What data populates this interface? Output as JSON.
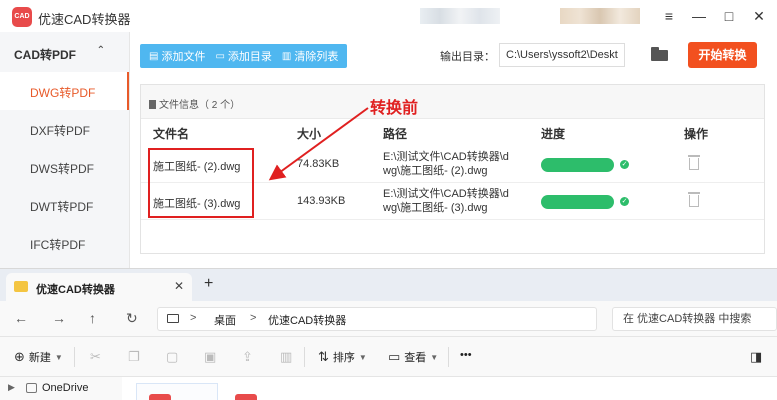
{
  "app": {
    "title": "优速CAD转换器",
    "logo_text": "CAD",
    "window_controls": [
      "≡",
      "—",
      "□",
      "✕"
    ]
  },
  "sidebar": {
    "group_label": "CAD转PDF",
    "group_chevron": "⌃",
    "items": [
      {
        "label": "DWG转PDF",
        "active": true
      },
      {
        "label": "DXF转PDF",
        "active": false
      },
      {
        "label": "DWS转PDF",
        "active": false
      },
      {
        "label": "DWT转PDF",
        "active": false
      },
      {
        "label": "IFC转PDF",
        "active": false
      }
    ]
  },
  "toolbar": {
    "add_file": "添加文件",
    "add_dir": "添加目录",
    "clear_list": "清除列表",
    "output_label": "输出目录：",
    "output_path": "C:\\Users\\yssoft2\\Deskt",
    "start_button": "开始转换"
  },
  "file_panel": {
    "header": "文件信息（ 2 个）",
    "columns": [
      "文件名",
      "大小",
      "路径",
      "进度",
      "操作"
    ],
    "rows": [
      {
        "name": "施工图纸- (2).dwg",
        "size": "74.83KB",
        "path_line1": "E:\\测试文件\\CAD转换器\\d",
        "path_line2": "wg\\施工图纸- (2).dwg",
        "progress": 1.0
      },
      {
        "name": "施工图纸- (3).dwg",
        "size": "143.93KB",
        "path_line1": "E:\\测试文件\\CAD转换器\\d",
        "path_line2": "wg\\施工图纸- (3).dwg",
        "progress": 1.0
      }
    ]
  },
  "annotation": {
    "label": "转换前",
    "color": "#e02020"
  },
  "explorer": {
    "tab_title": "优速CAD转换器",
    "tab_close": "✕",
    "new_tab": "+",
    "nav": [
      "←",
      "→",
      "↑",
      "↻"
    ],
    "breadcrumb": [
      "桌面",
      "优速CAD转换器"
    ],
    "breadcrumb_sep": ">",
    "search_placeholder": "在 优速CAD转换器 中搜索",
    "cmd": {
      "new_label": "新建",
      "sort_label": "排序",
      "view_label": "查看",
      "more": "•••"
    },
    "nav_pane": {
      "onedrive": "OneDrive"
    }
  },
  "colors": {
    "accent_orange": "#f2501f",
    "toolbar_blue": "#4fb7f0",
    "progress_green": "#2dbd6b"
  }
}
